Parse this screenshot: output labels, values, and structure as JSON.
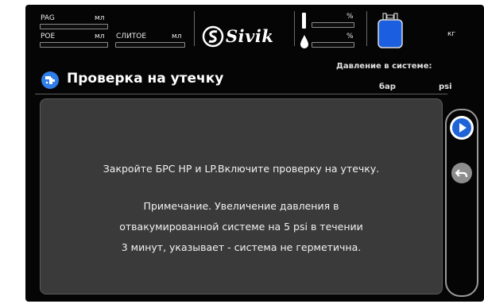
{
  "header": {
    "pag_label": "PAG",
    "pag_unit": "мл",
    "poe_label": "POE",
    "poe_unit": "мл",
    "drain_label": "СЛИТОЕ",
    "drain_unit": "мл",
    "brand": "Sivik",
    "percent_top": "%",
    "percent_bottom": "%",
    "weight_unit": "кг"
  },
  "page": {
    "title": "Проверка на утечку",
    "pressure_label": "Давление в системе:",
    "unit_bar": "бар",
    "unit_psi": "psi"
  },
  "message": {
    "line1": "Закройте БРС HP и LP.Включите проверку на утечку.",
    "line2": "Примечание. Увеличение давления в",
    "line3": "отвакумированной системе на 5 psi  в течении",
    "line4": "3 минут, указывает -  система не герметична."
  },
  "icons": {
    "title": "leak-test-icon",
    "next": "play-icon",
    "back": "back-arrow-icon",
    "tank": "refrigerant-tank-icon",
    "logo": "sivik-logo-icon",
    "oil": "oil-drop-icon",
    "thermo": "level-gauge-icon"
  },
  "colors": {
    "accent": "#2f7de6",
    "panel": "#3a3a3a",
    "background": "#050505"
  }
}
